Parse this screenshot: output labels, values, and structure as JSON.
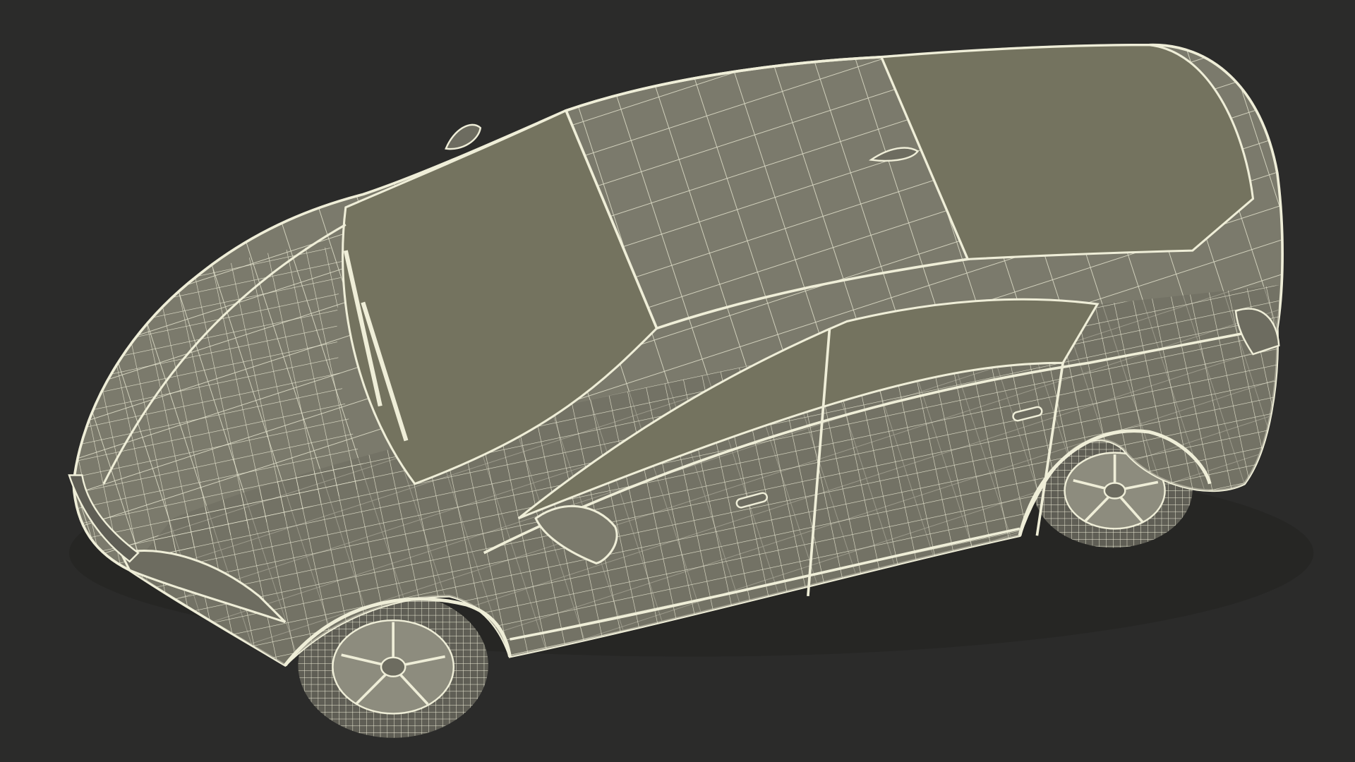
{
  "scene": {
    "subject": "car-wireframe",
    "view": "top-three-quarter",
    "colors": {
      "background": "#2b2b2a",
      "body_fill": "#7b7a6c",
      "body_shade": "#6d6c60",
      "glass_fill": "#74735f",
      "wire": "#efeed8",
      "tire": "#5f5e55",
      "rim": "#8d8c7e"
    }
  }
}
